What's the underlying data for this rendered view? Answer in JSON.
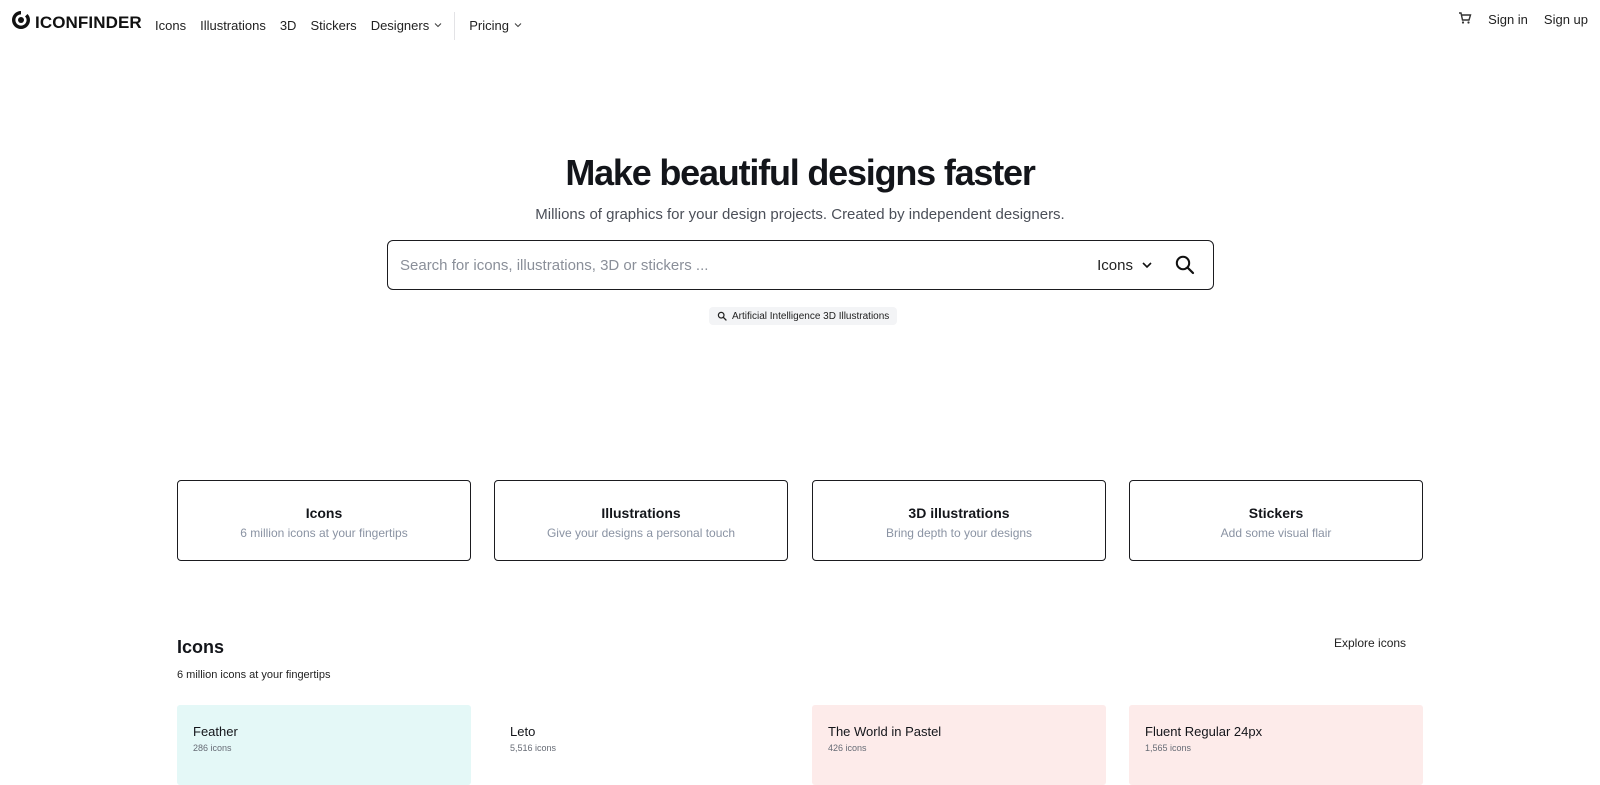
{
  "header": {
    "logo_text": "ICONFINDER",
    "nav": [
      "Icons",
      "Illustrations",
      "3D",
      "Stickers"
    ],
    "designers_label": "Designers",
    "pricing_label": "Pricing",
    "sign_in": "Sign in",
    "sign_up": "Sign up",
    "icons": {
      "logo": "iconfinder-logo-icon",
      "cart": "cart-icon",
      "dropdown": "chevron-down-icon"
    }
  },
  "hero": {
    "title_before": "Make ",
    "title_highlight": "beautiful designs",
    "title_after": " faster",
    "highlight_color": "#fbe4bd",
    "subtitle": "Millions of graphics for your design projects. Created by independent designers."
  },
  "search": {
    "placeholder": "Search for icons, illustrations, 3D or stickers ...",
    "value": "",
    "type_selected": "Icons",
    "icons": {
      "search": "search-icon",
      "dropdown": "chevron-down-icon"
    }
  },
  "suggestion": {
    "label": "Artificial Intelligence 3D Illustrations",
    "icon": "search-icon"
  },
  "categories": [
    {
      "title": "Icons",
      "subtitle": "6 million icons at your fingertips"
    },
    {
      "title": "Illustrations",
      "subtitle": "Give your designs a personal touch"
    },
    {
      "title": "3D illustrations",
      "subtitle": "Bring depth to your designs"
    },
    {
      "title": "Stickers",
      "subtitle": "Add some visual flair"
    }
  ],
  "icons_section": {
    "title": "Icons",
    "subtitle": "6 million icons at your fingertips",
    "explore_label": "Explore icons",
    "sets": [
      {
        "name": "Feather",
        "count": "286 icons",
        "bg": "#e4f8f7"
      },
      {
        "name": "Leto",
        "count": "5,516 icons",
        "bg": "#ffffff"
      },
      {
        "name": "The World in Pastel",
        "count": "426 icons",
        "bg": "#fdebea"
      },
      {
        "name": "Fluent Regular 24px",
        "count": "1,565 icons",
        "bg": "#fdebea"
      }
    ]
  },
  "colors": {
    "text": "#13151a",
    "muted": "#8a93a3",
    "border": "#1b1b1f"
  }
}
